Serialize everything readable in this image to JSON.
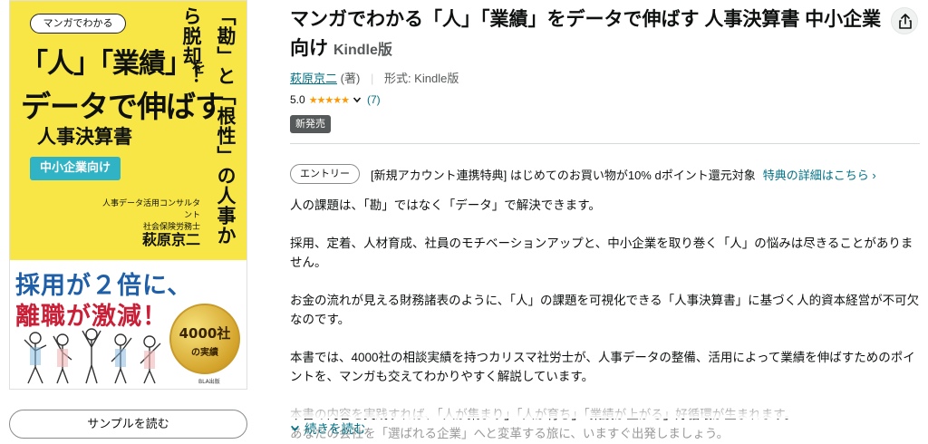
{
  "cover": {
    "tag": "マンガでわかる",
    "title_part1": "「人」「業績」",
    "title_particle": "を",
    "title_line2": "データで伸ばす",
    "title_line3": "人事決算書",
    "sme_label": "中小企業向け",
    "vertical_text": "「勘」と「根性」の人事から脱却！",
    "author_role_1": "人事データ活用コンサルタント",
    "author_role_2": "社会保険労務士",
    "author_name": "萩原京二",
    "promo_line1": "採用が２倍に、",
    "promo_line2": "離職が激減！",
    "seal_main": "4000社",
    "seal_sub": "の実績",
    "publisher": "BLA出版"
  },
  "sample_button": "サンプルを読む",
  "product": {
    "title": "マンガでわかる「人」「業績」をデータで伸ばす 人事決算書 中小企業向け",
    "format_label": "Kindle版",
    "author_link": "萩原京二",
    "author_role": "(著)",
    "format_prefix": "形式: Kindle版",
    "rating_value": "5.0",
    "stars": "★★★★★",
    "rating_count": "(7)",
    "new_badge": "新発売"
  },
  "promo": {
    "pill": "エントリー",
    "text": "[新規アカウント連携特典] はじめてのお買い物が10% dポイント還元対象",
    "link": "特典の詳細はこちら ›"
  },
  "description": {
    "p1": "人の課題は、「勘」ではなく「データ」で解決できます。",
    "p2": "採用、定着、人材育成、社員のモチベーションアップと、中小企業を取り巻く「人」の悩みは尽きることがありません。",
    "p3": "お金の流れが見える財務諸表のように、「人」の課題を可視化できる「人事決算書」に基づく人的資本経営が不可欠なのです。",
    "p4": "本書では、4000社の相談実績を持つカリスマ社労士が、人事データの整備、活用によって業績を伸ばすためのポイントを、マンガも交えてわかりやすく解説しています。",
    "p5": "本書の内容を実践すれば、「人が集まり」「人が育ち」「業績が上がる」好循環が生まれます。",
    "p6": "あなたの会社を「選ばれる企業」へと変革する旅に、いますぐ出発しましょう。"
  },
  "read_more": "続きを読む",
  "colors": {
    "link": "#007185",
    "star": "#ff9900",
    "cover_yellow": "#f7e645",
    "badge": "#565959"
  }
}
